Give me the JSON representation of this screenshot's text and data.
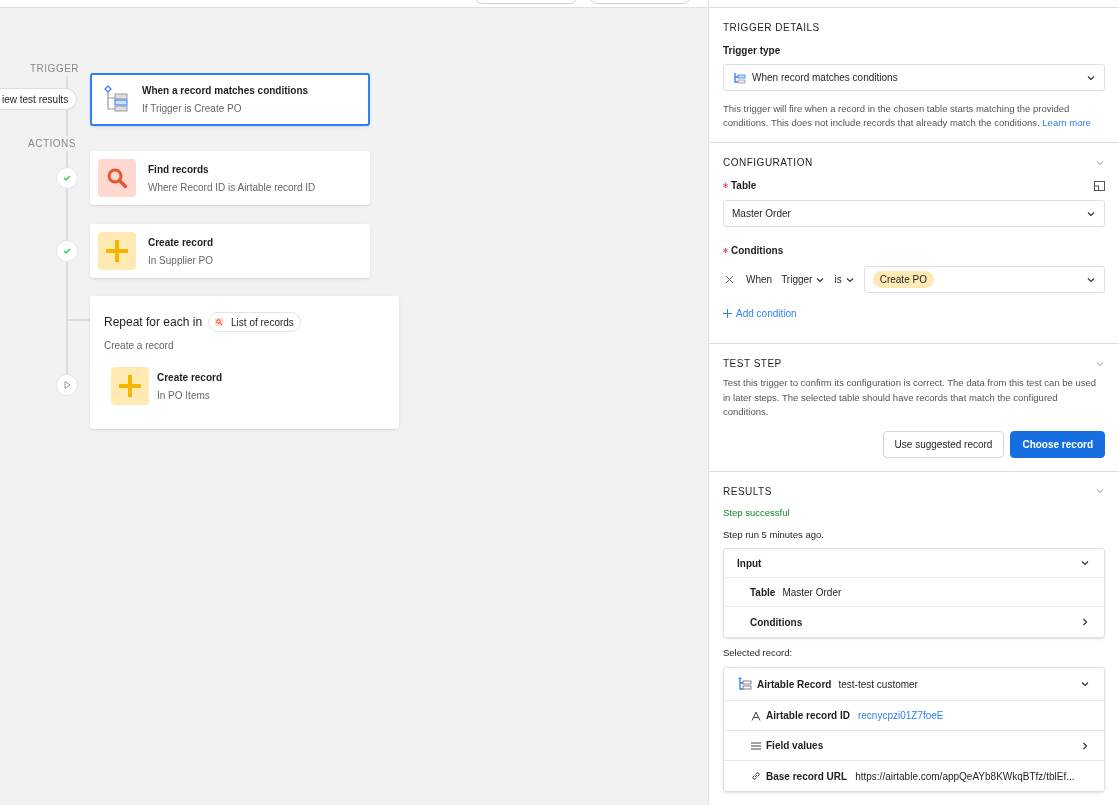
{
  "canvas": {
    "trigger_label": "TRIGGER",
    "view_results": "iew test results",
    "actions_label": "ACTIONS",
    "trigger": {
      "title": "When a record matches conditions",
      "subtitle": "If Trigger is Create PO",
      "selected": true
    },
    "steps": [
      {
        "kind": "find",
        "title": "Find records",
        "subtitle": "Where Record ID is Airtable record ID",
        "done": true
      },
      {
        "kind": "create",
        "title": "Create record",
        "subtitle": "In Supplier PO",
        "done": true
      }
    ],
    "loop": {
      "title": "Repeat for each in",
      "token": "List of records",
      "subtitle": "Create a record",
      "step": {
        "kind": "create",
        "title": "Create record",
        "subtitle": "In PO Items",
        "done": false
      }
    }
  },
  "panel": {
    "trigger_details": {
      "heading": "TRIGGER DETAILS",
      "type_label": "Trigger type",
      "type_value": "When record matches conditions",
      "description": "This trigger will fire when a record in the chosen table starts matching the provided conditions. This does not include records that already match the conditions.",
      "link": "Learn more"
    },
    "configuration": {
      "heading": "CONFIGURATION",
      "table_label": "Table",
      "table_value": "Master Order",
      "conditions_label": "Conditions",
      "condition": {
        "when": "When",
        "field": "Trigger",
        "operator": "is",
        "value": "Create PO"
      },
      "add_condition": "Add condition"
    },
    "test_step": {
      "heading": "TEST STEP",
      "description": "Test this trigger to confirm its configuration is correct. The data from this test can be used in later steps. The selected table should have records that match the configured conditions.",
      "buttons": [
        {
          "label": "Use suggested record",
          "kind": "secondary"
        },
        {
          "label": "Choose record",
          "kind": "primary"
        }
      ]
    },
    "results": {
      "heading": "RESULTS",
      "status": "Step successful",
      "run_time": "Step run 5 minutes ago.",
      "input": {
        "title": "Input",
        "table_key": "Table",
        "table_value": "Master Order",
        "conditions": "Conditions"
      },
      "selected_label": "Selected record:",
      "record": {
        "title": "Airtable Record",
        "name": "test-test customer",
        "fields": [
          {
            "kind": "text",
            "key": "Airtable record ID",
            "value": "recnycpzi01Z7foeE"
          },
          {
            "kind": "list",
            "key": "Field values"
          },
          {
            "kind": "link",
            "key": "Base record URL",
            "value": "https://airtable.com/appQeAYb8KWkqBTfz/tblEf..."
          }
        ]
      }
    }
  }
}
